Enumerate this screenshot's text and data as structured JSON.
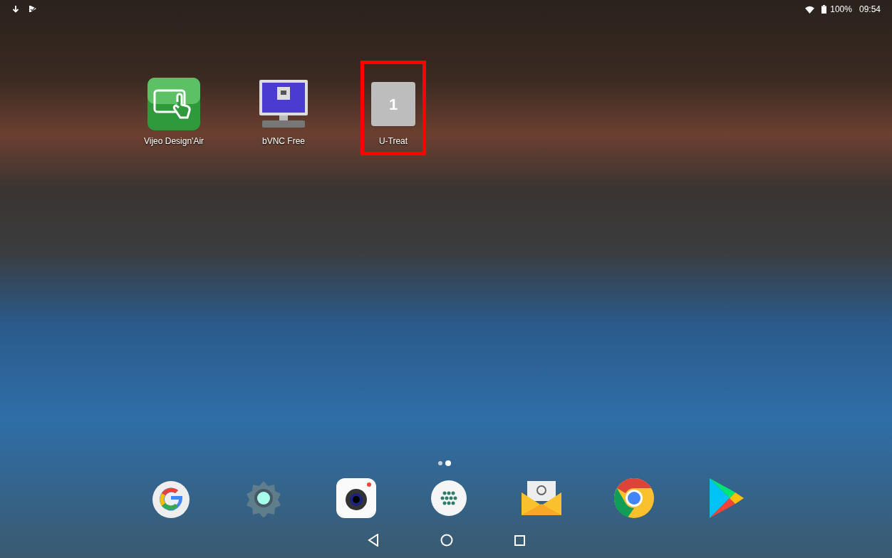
{
  "status_bar": {
    "battery": "100%",
    "time": "09:54"
  },
  "apps": [
    {
      "label": "Vijeo Design'Air",
      "kind": "vijeo",
      "highlighted": false
    },
    {
      "label": "bVNC Free",
      "kind": "vnc",
      "highlighted": false
    },
    {
      "label": "U-Treat",
      "kind": "placeholder",
      "icon_text": "1",
      "highlighted": true
    }
  ],
  "page_indicator": [
    {
      "selected": false
    },
    {
      "selected": true
    }
  ],
  "dock": [
    {
      "kind": "google"
    },
    {
      "kind": "settings"
    },
    {
      "kind": "camera"
    },
    {
      "kind": "launcher"
    },
    {
      "kind": "email"
    },
    {
      "kind": "chrome"
    },
    {
      "kind": "play"
    }
  ]
}
